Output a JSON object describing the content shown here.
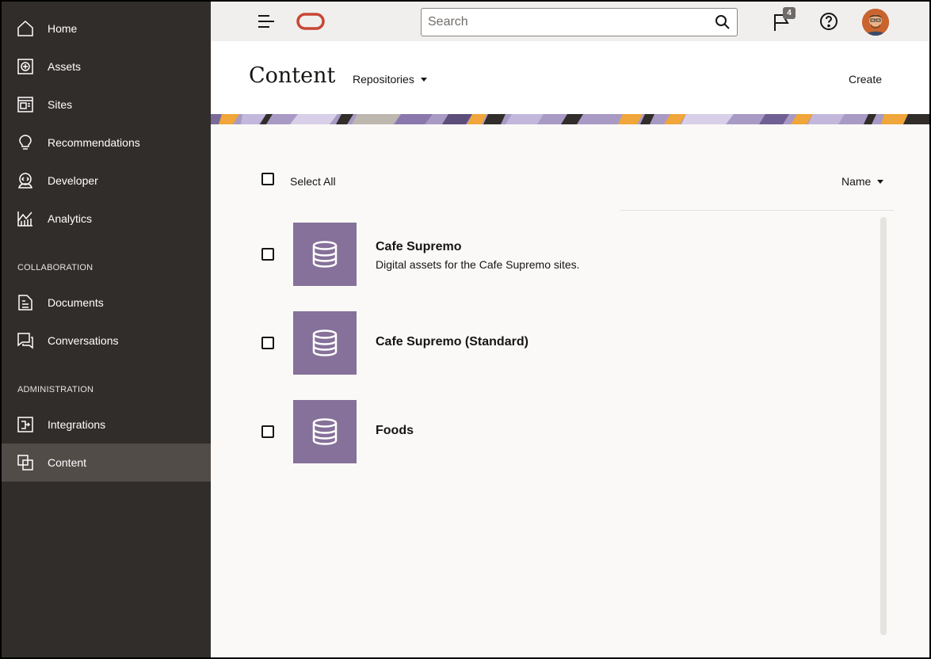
{
  "sidebar": {
    "items": [
      {
        "label": "Home",
        "icon": "home-icon"
      },
      {
        "label": "Assets",
        "icon": "assets-icon"
      },
      {
        "label": "Sites",
        "icon": "sites-icon"
      },
      {
        "label": "Recommendations",
        "icon": "lightbulb-icon"
      },
      {
        "label": "Developer",
        "icon": "developer-icon"
      },
      {
        "label": "Analytics",
        "icon": "analytics-icon"
      }
    ],
    "collaboration_label": "COLLABORATION",
    "collaboration_items": [
      {
        "label": "Documents",
        "icon": "documents-icon"
      },
      {
        "label": "Conversations",
        "icon": "conversations-icon"
      }
    ],
    "administration_label": "ADMINISTRATION",
    "administration_items": [
      {
        "label": "Integrations",
        "icon": "integrations-icon"
      },
      {
        "label": "Content",
        "icon": "content-icon",
        "active": true
      }
    ]
  },
  "topbar": {
    "search_placeholder": "Search",
    "notification_count": "4"
  },
  "header": {
    "title": "Content",
    "repositories_label": "Repositories",
    "create_label": "Create"
  },
  "list": {
    "select_all_label": "Select All",
    "sort_label": "Name",
    "repositories": [
      {
        "name": "Cafe Supremo",
        "description": "Digital assets for the Cafe Supremo sites."
      },
      {
        "name": "Cafe Supremo (Standard)",
        "description": ""
      },
      {
        "name": "Foods",
        "description": ""
      }
    ]
  },
  "colors": {
    "sidebar_bg": "#312d2a",
    "sidebar_active": "#524c48",
    "tile_purple": "#86719a",
    "oracle_red": "#c74634"
  }
}
